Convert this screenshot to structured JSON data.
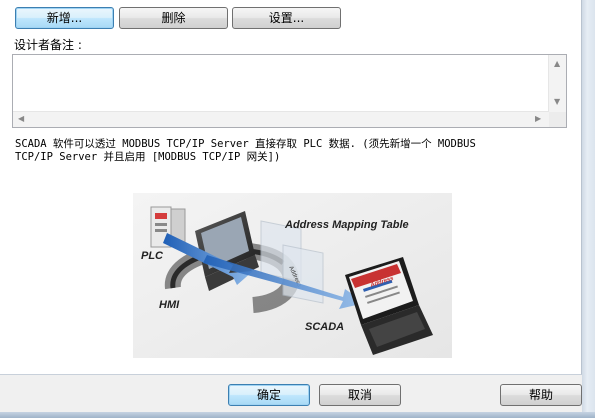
{
  "toolbar": {
    "add_label": "新增...",
    "delete_label": "删除",
    "settings_label": "设置..."
  },
  "notes": {
    "label": "设计者备注 :",
    "value": ""
  },
  "description": {
    "line1": "SCADA 软件可以透过 MODBUS TCP/IP Server 直接存取 PLC 数据. (须先新增一个 MODBUS",
    "line2": "TCP/IP Server 并且启用 [MODBUS TCP/IP 网关])"
  },
  "illustration": {
    "title": "Address Mapping Table",
    "plc": "PLC",
    "hmi": "HMI",
    "scada": "SCADA",
    "panel_tag": "Address",
    "screen_tag": "Address"
  },
  "footer": {
    "ok_label": "确定",
    "cancel_label": "取消",
    "help_label": "帮助"
  }
}
